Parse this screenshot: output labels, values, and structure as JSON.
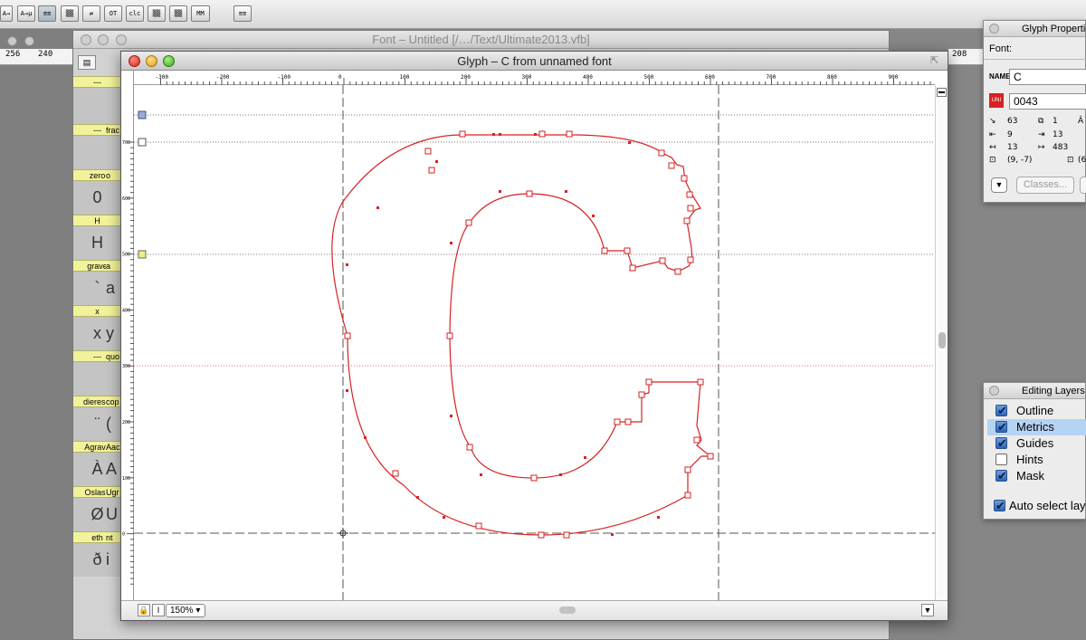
{
  "toolbar": {
    "buttons": [
      "A→",
      "A→µ",
      "≡≡",
      "▒▒",
      "⇄",
      "OT",
      "clc",
      "▒▒",
      "▒▒",
      "MM",
      "≡≡"
    ],
    "active_index": 2
  },
  "left_ruler": {
    "ticks": [
      "256",
      "240"
    ]
  },
  "font_window": {
    "title": "Font – Untitled [/…/Text/Ultimate2013.vfb]",
    "col2_names": [
      "",
      "frac",
      "o",
      "",
      "a",
      "",
      "quo",
      "cop",
      "Aac",
      "Ugr",
      "nt"
    ],
    "glyphs": [
      {
        "name": "---",
        "char": ""
      },
      {
        "name": "---",
        "char": ""
      },
      {
        "name": "zero",
        "char": "0"
      },
      {
        "name": "H",
        "char": "H"
      },
      {
        "name": "grave",
        "char": "`"
      },
      {
        "name": "x",
        "char": "x"
      },
      {
        "name": "---",
        "char": ""
      },
      {
        "name": "dieresis",
        "char": "¨"
      },
      {
        "name": "Agrave",
        "char": "À"
      },
      {
        "name": "Oslash",
        "char": "Ø"
      },
      {
        "name": "eth",
        "char": "ð"
      }
    ],
    "col2_chars": [
      "",
      "",
      "",
      "",
      "a",
      "y",
      "",
      "(",
      "A",
      "U",
      "i"
    ],
    "right_ruler_value": "208"
  },
  "glyph_window": {
    "title": "Glyph – C from unnamed font",
    "zoom": "150%",
    "hruler_ticks": [
      "-300",
      "-200",
      "-100",
      "0",
      "100",
      "200",
      "300",
      "400",
      "500",
      "600",
      "700",
      "800",
      "900",
      "1000"
    ],
    "vruler_ticks": [
      "700",
      "600",
      "500",
      "400",
      "300",
      "200",
      "100",
      "0"
    ],
    "guide_colors": {
      "outline": "#d62222",
      "metric": "#555555",
      "node": "#d62222"
    }
  },
  "glyph_properties": {
    "title": "Glyph Properties",
    "font_label": "Font:",
    "name_label": "NAME",
    "name_value": "C",
    "unicode_label": "UNI",
    "unicode_value": "0043",
    "metrics": [
      "63",
      "1",
      "Â",
      "9",
      "13",
      "13",
      "483",
      "(9, -7)",
      "(6"
    ],
    "classes_button": "Classes..."
  },
  "editing_layers": {
    "title": "Editing Layers",
    "layers": [
      {
        "label": "Outline",
        "checked": true,
        "selected": false
      },
      {
        "label": "Metrics",
        "checked": true,
        "selected": true
      },
      {
        "label": "Guides",
        "checked": true,
        "selected": false
      },
      {
        "label": "Hints",
        "checked": false,
        "selected": false
      },
      {
        "label": "Mask",
        "checked": true,
        "selected": false
      }
    ],
    "auto_select": {
      "label": "Auto select layer",
      "checked": true
    }
  }
}
